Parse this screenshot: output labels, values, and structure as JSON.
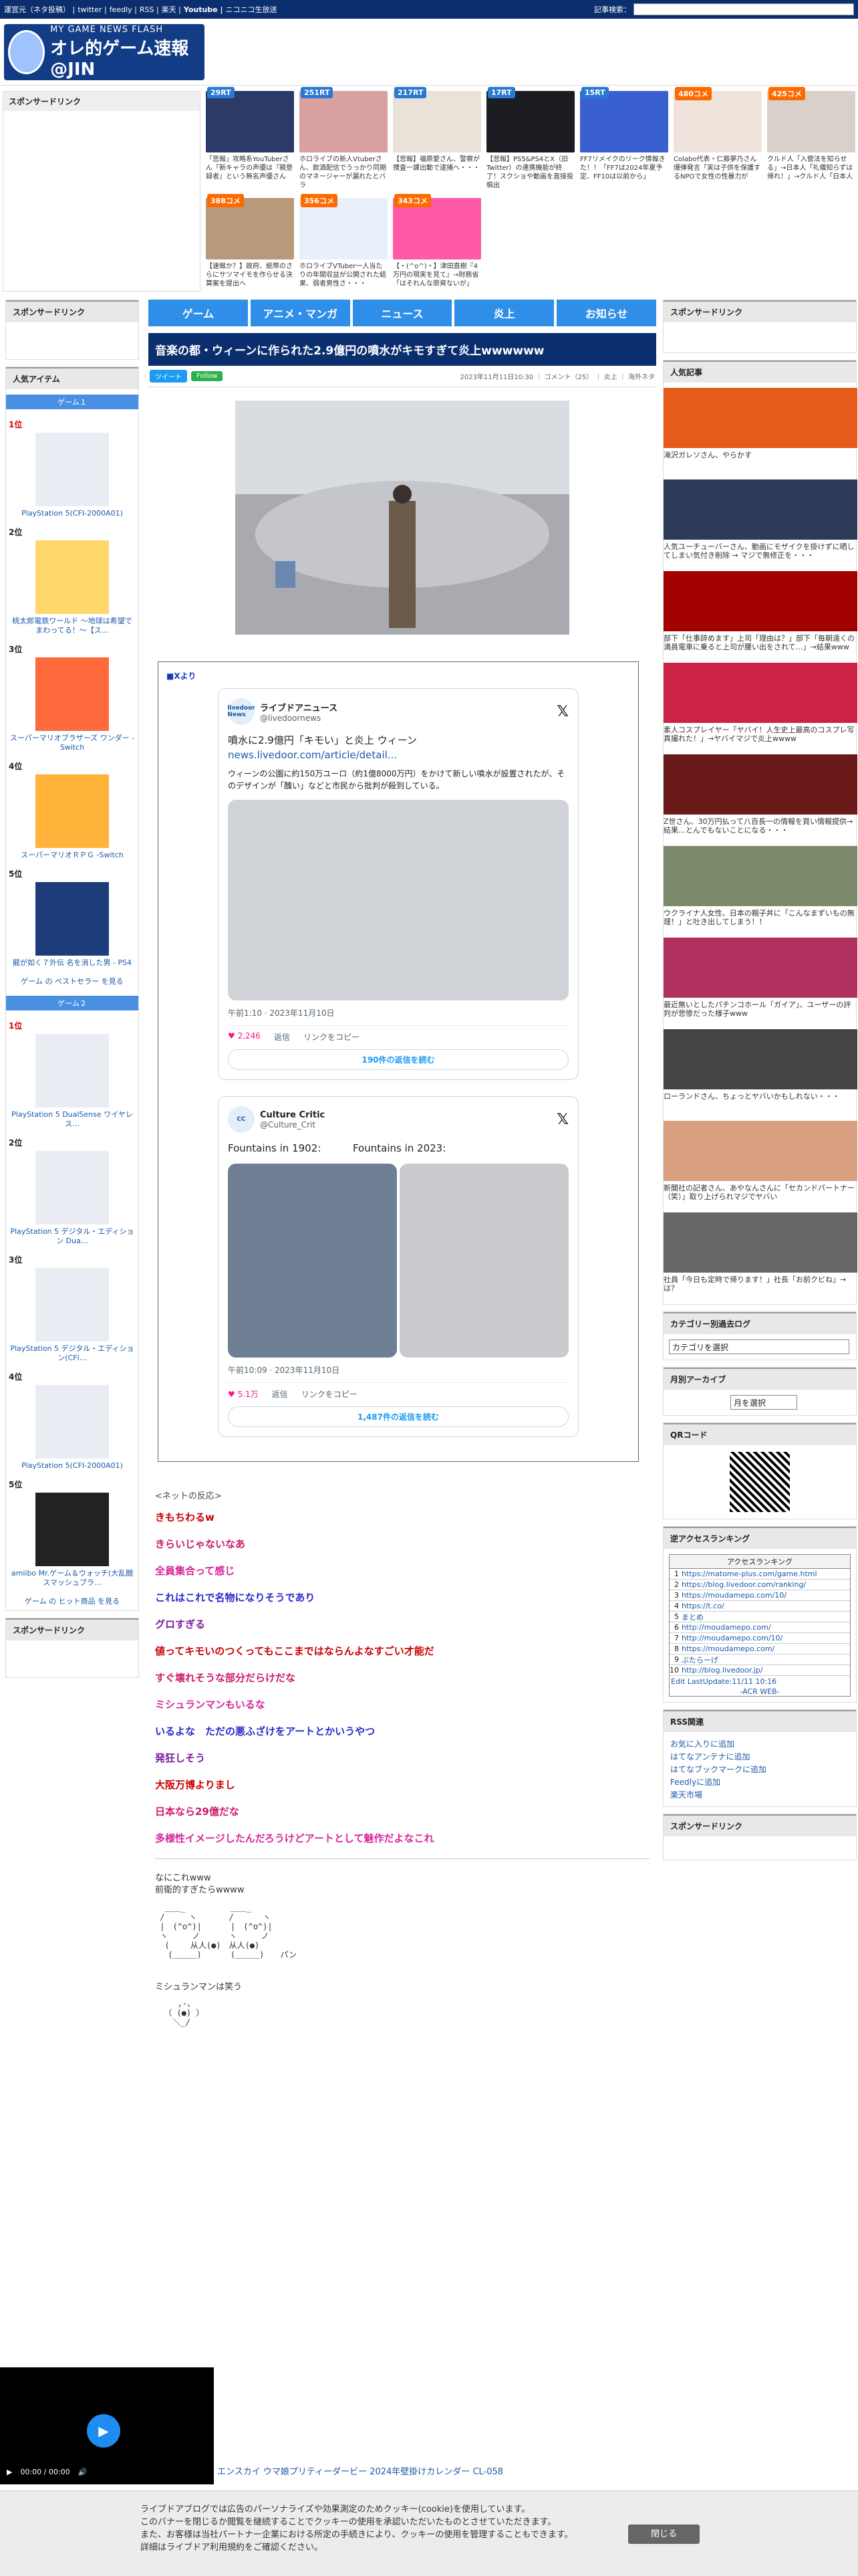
{
  "topstrip": {
    "links": [
      "運営元（ネタ投稿）",
      "twitter",
      "feedly",
      "RSS",
      "楽天",
      "Youtube",
      "ニコニコ生放送"
    ],
    "search_label": "記事検索："
  },
  "logo": {
    "line1": "MY GAME NEWS FLASH",
    "line2": "オレ的ゲーム速報@JIN"
  },
  "sponsor_title": "スポンサードリンク",
  "thumbs": [
    {
      "badge": "29RT",
      "kind": "rt",
      "cap": "「悲報」攻略系YouTuberさん「新キャラの声優は『親登録者』という無名声優さん"
    },
    {
      "badge": "251RT",
      "kind": "rt",
      "cap": "ホロライブの新人Vtuberさん、飲酒配信でうっかり同期のマネージャーが漏れたとバラ"
    },
    {
      "badge": "217RT",
      "kind": "rt",
      "cap": "【悲報】福原愛さん、警察が捜査一課出動で逮捕へ・・・"
    },
    {
      "badge": "17RT",
      "kind": "rt",
      "cap": "【悲報】PS5&PS4とX（旧Twitter）の連携機能が終了！スクショや動画を直接投稿出"
    },
    {
      "badge": "15RT",
      "kind": "rt",
      "cap": "FF7リメイクのリーク情報きた！！「FF7は2024年夏予定、FF10は以前から」"
    },
    {
      "badge": "480コメ",
      "kind": "cm",
      "cap": "Colabo代表・仁藤夢乃さん爆弾発言「実は子供を保護するNPOで女性の性暴力が"
    },
    {
      "badge": "425コメ",
      "kind": "cm",
      "cap": "クルド人「入管法を知らせる」→日本人「礼儀知らずは帰れ！」→クルド人「日本人"
    },
    {
      "badge": "388コメ",
      "kind": "cm",
      "cap": "【速報か？】政府、紙幣のさらにサツマイモを作らせる決算案を提出へ"
    },
    {
      "badge": "356コメ",
      "kind": "cm",
      "cap": "ホロライブVTuber一人当たりの年間収益が公開された結果、弱者男性さ・・・"
    },
    {
      "badge": "343コメ",
      "kind": "cm",
      "cap": "【・(^o^)・】津田直樹『4万円の現実を見て』→財務省「はそれんな原資ないが」"
    }
  ],
  "nav": [
    "ゲーム",
    "アニメ・マンガ",
    "ニュース",
    "炎上",
    "お知らせ"
  ],
  "article": {
    "title": "音楽の都・ウィーンに作られた2.9億円の噴水がキモすぎて炎上wwwwww",
    "meta": "2023年11月11日10:30 ｜ コメント（25） ｜ 炎上 ｜ 海外ネタ",
    "tweet_btn": "ツイート",
    "feedly_btn": "Follow",
    "embed_src": "■Xより",
    "tweet1": {
      "avatar": "livedoor News",
      "name": "ライブドアニュース",
      "handle": "@livedoornews",
      "body": "噴水に2.9億円「キモい」と炎上 ウィーン",
      "link": "news.livedoor.com/article/detail...",
      "text": "ウィーンの公園に約150万ユーロ（約1億8000万円）をかけて新しい噴水が設置されたが、そのデザインが「醜い」などと市民から批判が殺到している。",
      "ts": "午前1:10 · 2023年11月10日",
      "likes": "2,246",
      "reply": "返信",
      "share": "リンクをコピー",
      "more": "190件の返信を読む"
    },
    "tweet2": {
      "avatar": "CC",
      "name": "Culture Critic",
      "handle": "@Culture_Crit",
      "body": "Fountains in 1902:          Fountains in 2023:",
      "ts": "午前10:09 · 2023年11月10日",
      "likes": "5.1万",
      "reply": "返信",
      "share": "リンクをコピー",
      "more": "1,487件の返信を読む"
    },
    "reactions_label": "<ネットの反応>",
    "reactions": [
      {
        "t": "きもちわるw",
        "c": "#cc0000"
      },
      {
        "t": "きらいじゃないなあ",
        "c": "#cc1a6a"
      },
      {
        "t": "全員集合って感じ",
        "c": "#d6259b"
      },
      {
        "t": "これはこれで名物になりそうであり",
        "c": "#2929c8"
      },
      {
        "t": "グロすぎる",
        "c": "#7a1aa0"
      },
      {
        "t": "値ってキモいのつくってもここまではならんよなすごい才能だ",
        "c": "#cc0000"
      },
      {
        "t": "すぐ壊れそうな部分だらけだな",
        "c": "#cc1a6a"
      },
      {
        "t": "ミシュランマンもいるな",
        "c": "#d6259b"
      },
      {
        "t": "いるよな　ただの悪ふざけをアートとかいうやつ",
        "c": "#2929c8"
      },
      {
        "t": "発狂しそう",
        "c": "#7a1aa0"
      },
      {
        "t": "大阪万博よりまし",
        "c": "#cc0000"
      },
      {
        "t": "日本なら29億だな",
        "c": "#cc1a6a"
      },
      {
        "t": "多様性イメージしたんだろうけどアートとして魅作だよなこれ",
        "c": "#d6259b"
      }
    ],
    "aa1": "なにこれwww\n前衛的すぎたらwwww",
    "aa2": "ミシュランマンは笑う"
  },
  "left": {
    "popular_title": "人気アイテム",
    "game1": "ゲーム１",
    "game2": "ゲーム２",
    "items1": [
      {
        "rank": "1位",
        "name": "PlayStation 5(CFI-2000A01)",
        "color": "#e9edf3"
      },
      {
        "rank": "2位",
        "name": "桃太郎電鉄ワールド ～地球は希望でまわってる！～【ス…",
        "color": "#ffd76a"
      },
      {
        "rank": "3位",
        "name": "スーパーマリオブラザーズ ワンダー -Switch",
        "color": "#ff6a3d"
      },
      {
        "rank": "4位",
        "name": "スーパーマリオＲＰＧ -Switch",
        "color": "#ffb33a"
      },
      {
        "rank": "5位",
        "name": "龍が如く７外伝 名を消した男 - PS4",
        "color": "#1d3d7a"
      }
    ],
    "more1": "ゲーム の ベストセラー を見る",
    "items2": [
      {
        "rank": "1位",
        "name": "PlayStation 5 DualSense ワイヤレス…",
        "color": "#e9edf3"
      },
      {
        "rank": "2位",
        "name": "PlayStation 5 デジタル・エディション Dua…",
        "color": "#e9edf3"
      },
      {
        "rank": "3位",
        "name": "PlayStation 5 デジタル・エディション(CFI…",
        "color": "#e9edf3"
      },
      {
        "rank": "4位",
        "name": "PlayStation 5(CFI-2000A01)",
        "color": "#e9edf3"
      },
      {
        "rank": "5位",
        "name": "amiibo Mr.ゲーム＆ウォッチ(大乱闘スマッシュブラ…",
        "color": "#222"
      }
    ],
    "more2": "ゲーム の ヒット商品 を見る"
  },
  "right": {
    "popular_title": "人気記事",
    "items": [
      {
        "cap": "滝沢ガレソさん、やらかす",
        "color": "#e65a1a"
      },
      {
        "cap": "人気ユーチューバーさん、動画にモザイクを掛けずに晒してしまい気付き削除 → マジで無修正を・・・",
        "color": "#2d3b58"
      },
      {
        "cap": "部下「仕事辞めます」上司「理由は？」部下「毎朝遠くの満員電車に乗ると上司が腰い出をされて…」→結果www",
        "color": "#a30000"
      },
      {
        "cap": "素人コスプレイヤー「ヤバイ！人生史上最高のコスプレ写真撮れた！」→ヤバイマジで炎上wwww",
        "color": "#cc2244"
      },
      {
        "cap": "Z世さん、30万円払って八百長一の情報を買い情報提供→結果…とんでもないことになる・・・",
        "color": "#6b1a1a"
      },
      {
        "cap": "ウクライナ人女性、日本の親子丼に「こんなまずいもの無理！」と吐き出してしまう！！",
        "color": "#7a8a6a"
      },
      {
        "cap": "最近無いとしたパチンコホール「ガイア」、ユーザーの評判が悲惨だった様子www",
        "color": "#b03060"
      },
      {
        "cap": "ローランドさん、ちょっとヤバいかもしれない・・・",
        "color": "#444"
      },
      {
        "cap": "新聞社の記者さん、あやなんさんに「セカンドパートナー（笑）」取り上げられマジでヤバい",
        "color": "#d8a080"
      },
      {
        "cap": "社員「今日も定時で帰ります！」社長「お前クビね」→は？",
        "color": "#666"
      }
    ],
    "category_title": "カテゴリー別過去ログ",
    "category_select": "カテゴリを選択",
    "archive_title": "月別アーカイブ",
    "archive_select": "月を選択",
    "qr_title": "QRコード",
    "access_title": "逆アクセスランキング",
    "access_head": "アクセスランキング",
    "access_rows": [
      "https://matome-plus.com/game.html",
      "https://blog.livedoor.com/ranking/",
      "https://moudamepo.com/10/",
      "https://t.co/",
      "まとめ",
      "http://moudamepo.com/",
      "http://moudamepo.com/10/",
      "https://moudamepo.com/",
      "ぶたらーげ",
      "http://blog.livedoor.jp/"
    ],
    "access_update": "Edit LastUpdate:11/11 10:16",
    "access_footer": "-ACR WEB-",
    "rss_title": "RSS関連",
    "rss_links": [
      "お気に入りに追加",
      "はてなアンテナに追加",
      "はてなブックマークに追加",
      "Feedlyに追加",
      "楽天市場"
    ],
    "sponsor_bottom": "スポンサードリンク"
  },
  "video": {
    "time": "00:00 / 00:00"
  },
  "videofoot": "エンスカイ ウマ娘プリティーダービー 2024年壁掛けカレンダー CL-058",
  "cookie": {
    "l1": "ライブドアブログでは広告のパーソナライズや効果測定のためクッキー(cookie)を使用しています。",
    "l2": "このバナーを閉じるか閲覧を継続することでクッキーの使用を承認いただいたものとさせていただきます。",
    "l3": "また、お客様は当社パートナー企業における所定の手続きにより、クッキーの使用を管理することもできます。",
    "l4": "詳細はライブドア利用規約をご確認ください。",
    "close": "閉じる"
  }
}
